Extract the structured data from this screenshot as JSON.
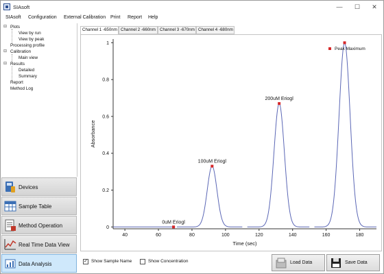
{
  "window": {
    "title": "SIAsoft"
  },
  "menu": [
    "SIAsoft",
    "Configuration",
    "External Calibration",
    "Print",
    "Report",
    "Help"
  ],
  "tree": {
    "plots": "Plots",
    "view_by_run": "View by run",
    "view_by_peak": "View by peak",
    "processing_profile": "Processing profile",
    "calibration": "Calibration",
    "main_view": "Main view",
    "results": "Results",
    "detailed": "Detailed",
    "summary": "Summary",
    "report": "Report",
    "method_log": "Method Log"
  },
  "nav": {
    "devices": "Devices",
    "sample_table": "Sample Table",
    "method_operation": "Method Operation",
    "real_time": "Real Time Data View",
    "data_analysis": "Data Analysis"
  },
  "tabs": [
    "Channel 1 -650nm",
    "Channel 2 -660nm",
    "Channel 3 -670nm",
    "Channel 4 -680nm"
  ],
  "bottom": {
    "show_sample_name": "Show Sample Name",
    "show_sample_name_checked": true,
    "show_concentration": "Show Concentration",
    "show_concentration_checked": false,
    "load_data": "Load Data",
    "save_data": "Save Data"
  },
  "colors": {
    "trace": "#5a66b5",
    "peak_marker": "#d62728",
    "active_nav": "#cfe8fb"
  },
  "chart_data": {
    "type": "line",
    "xlabel": "Time (sec)",
    "ylabel": "Absorbance",
    "xlim": [
      33,
      190
    ],
    "ylim": [
      -0.01,
      1.02
    ],
    "x_ticks": [
      40,
      60,
      80,
      100,
      120,
      140,
      160,
      180
    ],
    "y_ticks": [
      0,
      0.2,
      0.4,
      0.6,
      0.8,
      1
    ],
    "y_tick_labels": [
      "0",
      "0.2",
      "0.4",
      "0.6",
      "0.8",
      "1"
    ],
    "legend": {
      "position": "top-right",
      "entries": [
        "Peak Maximum"
      ]
    },
    "segments": [
      {
        "x_range": [
          31,
          70
        ],
        "peak_x": 69,
        "peak_y": 0.0,
        "sigma": 3.0
      },
      {
        "x_range": [
          71,
          110
        ],
        "peak_x": 92,
        "peak_y": 0.33,
        "sigma": 2.9
      },
      {
        "x_range": [
          113,
          150
        ],
        "peak_x": 132,
        "peak_y": 0.67,
        "sigma": 3.1
      },
      {
        "x_range": [
          153,
          190
        ],
        "peak_x": 171,
        "peak_y": 1.0,
        "sigma": 3.3
      }
    ],
    "peaks": [
      {
        "label": "0uM Eriogl",
        "x": 69,
        "y": 0.0
      },
      {
        "label": "100uM Eriogl",
        "x": 92,
        "y": 0.33
      },
      {
        "label": "200uM Eriogl",
        "x": 132,
        "y": 0.67
      },
      {
        "label": "",
        "x": 171,
        "y": 1.0
      }
    ]
  }
}
